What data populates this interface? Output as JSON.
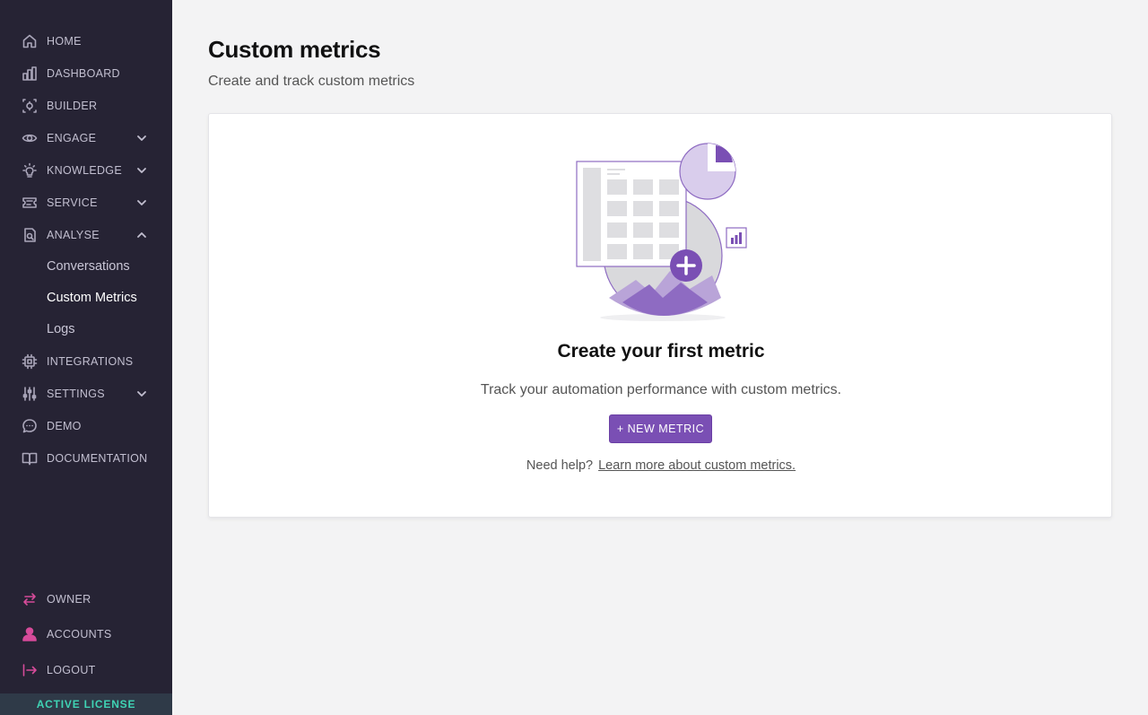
{
  "sidebar": {
    "items": [
      {
        "label": "HOME",
        "icon": "home-icon"
      },
      {
        "label": "DASHBOARD",
        "icon": "bar-chart-icon"
      },
      {
        "label": "BUILDER",
        "icon": "builder-icon"
      },
      {
        "label": "ENGAGE",
        "icon": "eye-icon"
      },
      {
        "label": "KNOWLEDGE",
        "icon": "lightbulb-icon"
      },
      {
        "label": "SERVICE",
        "icon": "ticket-icon"
      },
      {
        "label": "ANALYSE",
        "icon": "analyse-icon"
      },
      {
        "label": "INTEGRATIONS",
        "icon": "chip-icon"
      },
      {
        "label": "SETTINGS",
        "icon": "sliders-icon"
      },
      {
        "label": "DEMO",
        "icon": "chat-icon"
      },
      {
        "label": "DOCUMENTATION",
        "icon": "book-icon"
      }
    ],
    "analyse_sub": [
      "Conversations",
      "Custom Metrics",
      "Logs"
    ],
    "bottom": [
      {
        "label": "OWNER",
        "icon": "swap-icon"
      },
      {
        "label": "ACCOUNTS",
        "icon": "user-icon"
      },
      {
        "label": "LOGOUT",
        "icon": "logout-icon"
      }
    ],
    "license": "ACTIVE LICENSE"
  },
  "main": {
    "title": "Custom metrics",
    "subtitle": "Create and track custom metrics",
    "empty": {
      "title": "Create your first metric",
      "text": "Track your automation performance with custom metrics.",
      "button": "+ NEW METRIC",
      "help_prefix": "Need help?",
      "help_link": "Learn more about custom metrics."
    }
  },
  "colors": {
    "sidebar_bg": "#262334",
    "accent": "#7a4fb4",
    "license_text": "#3fd3b4",
    "bottom_icon": "#d64b9a"
  }
}
